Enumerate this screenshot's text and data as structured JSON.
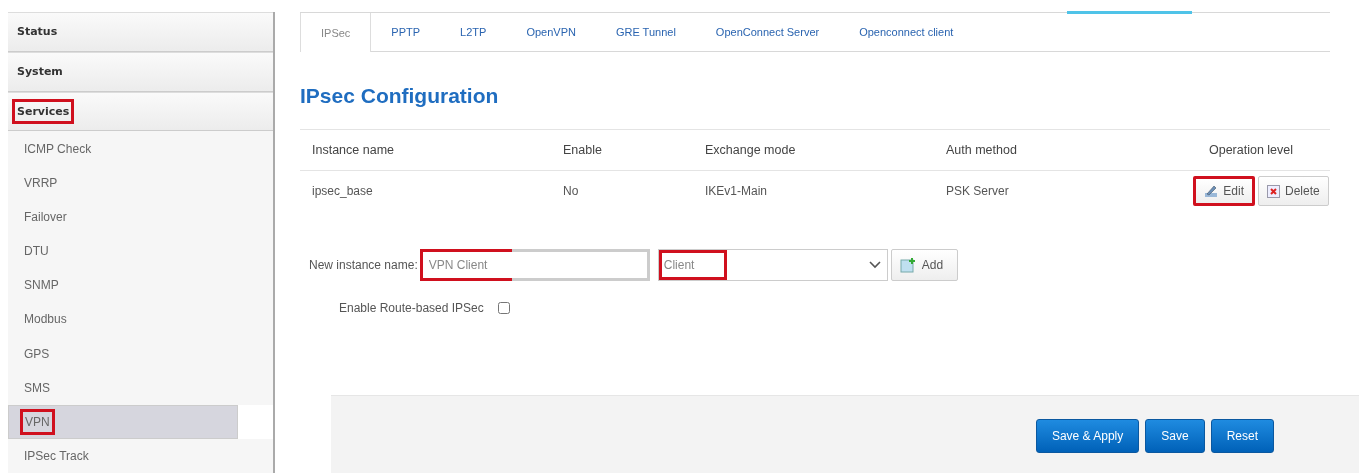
{
  "sidebar": {
    "items": [
      {
        "label": "Status",
        "kind": "section",
        "selected": false,
        "highlighted": false
      },
      {
        "label": "System",
        "kind": "section",
        "selected": false,
        "highlighted": false
      },
      {
        "label": "Services",
        "kind": "section",
        "selected": false,
        "highlighted": true
      },
      {
        "label": "ICMP Check",
        "kind": "sub",
        "selected": false,
        "highlighted": false
      },
      {
        "label": "VRRP",
        "kind": "sub",
        "selected": false,
        "highlighted": false
      },
      {
        "label": "Failover",
        "kind": "sub",
        "selected": false,
        "highlighted": false
      },
      {
        "label": "DTU",
        "kind": "sub",
        "selected": false,
        "highlighted": false
      },
      {
        "label": "SNMP",
        "kind": "sub",
        "selected": false,
        "highlighted": false
      },
      {
        "label": "Modbus",
        "kind": "sub",
        "selected": false,
        "highlighted": false
      },
      {
        "label": "GPS",
        "kind": "sub",
        "selected": false,
        "highlighted": false
      },
      {
        "label": "SMS",
        "kind": "sub",
        "selected": false,
        "highlighted": false
      },
      {
        "label": "VPN",
        "kind": "sub",
        "selected": true,
        "highlighted": true
      },
      {
        "label": "IPSec Track",
        "kind": "sub",
        "selected": false,
        "highlighted": false
      }
    ]
  },
  "tabs": [
    {
      "label": "IPSec",
      "selected": true
    },
    {
      "label": "PPTP",
      "selected": false
    },
    {
      "label": "L2TP",
      "selected": false
    },
    {
      "label": "OpenVPN",
      "selected": false
    },
    {
      "label": "GRE Tunnel",
      "selected": false
    },
    {
      "label": "OpenConnect Server",
      "selected": false
    },
    {
      "label": "Openconnect client",
      "selected": false
    }
  ],
  "title": "IPsec Configuration",
  "table": {
    "columns": [
      "Instance name",
      "Enable",
      "Exchange mode",
      "Auth method",
      "Operation level"
    ],
    "rows": [
      {
        "cells": [
          "ipsec_base",
          "No",
          "IKEv1-Main",
          "PSK Server"
        ],
        "actions": [
          {
            "label": "Edit",
            "kind": "edit",
            "highlighted": true
          },
          {
            "label": "Delete",
            "kind": "delete",
            "highlighted": false
          }
        ]
      }
    ]
  },
  "new_instance": {
    "label": "New instance name:",
    "name_value": "VPN Client",
    "name_highlighted": true,
    "mode_value": "Client",
    "mode_highlighted": true,
    "add_button": "Add"
  },
  "route_based": {
    "label": "Enable Route-based IPSec",
    "checked": false
  },
  "buttons": [
    {
      "label": "Save & Apply"
    },
    {
      "label": "Save"
    },
    {
      "label": "Reset"
    }
  ]
}
